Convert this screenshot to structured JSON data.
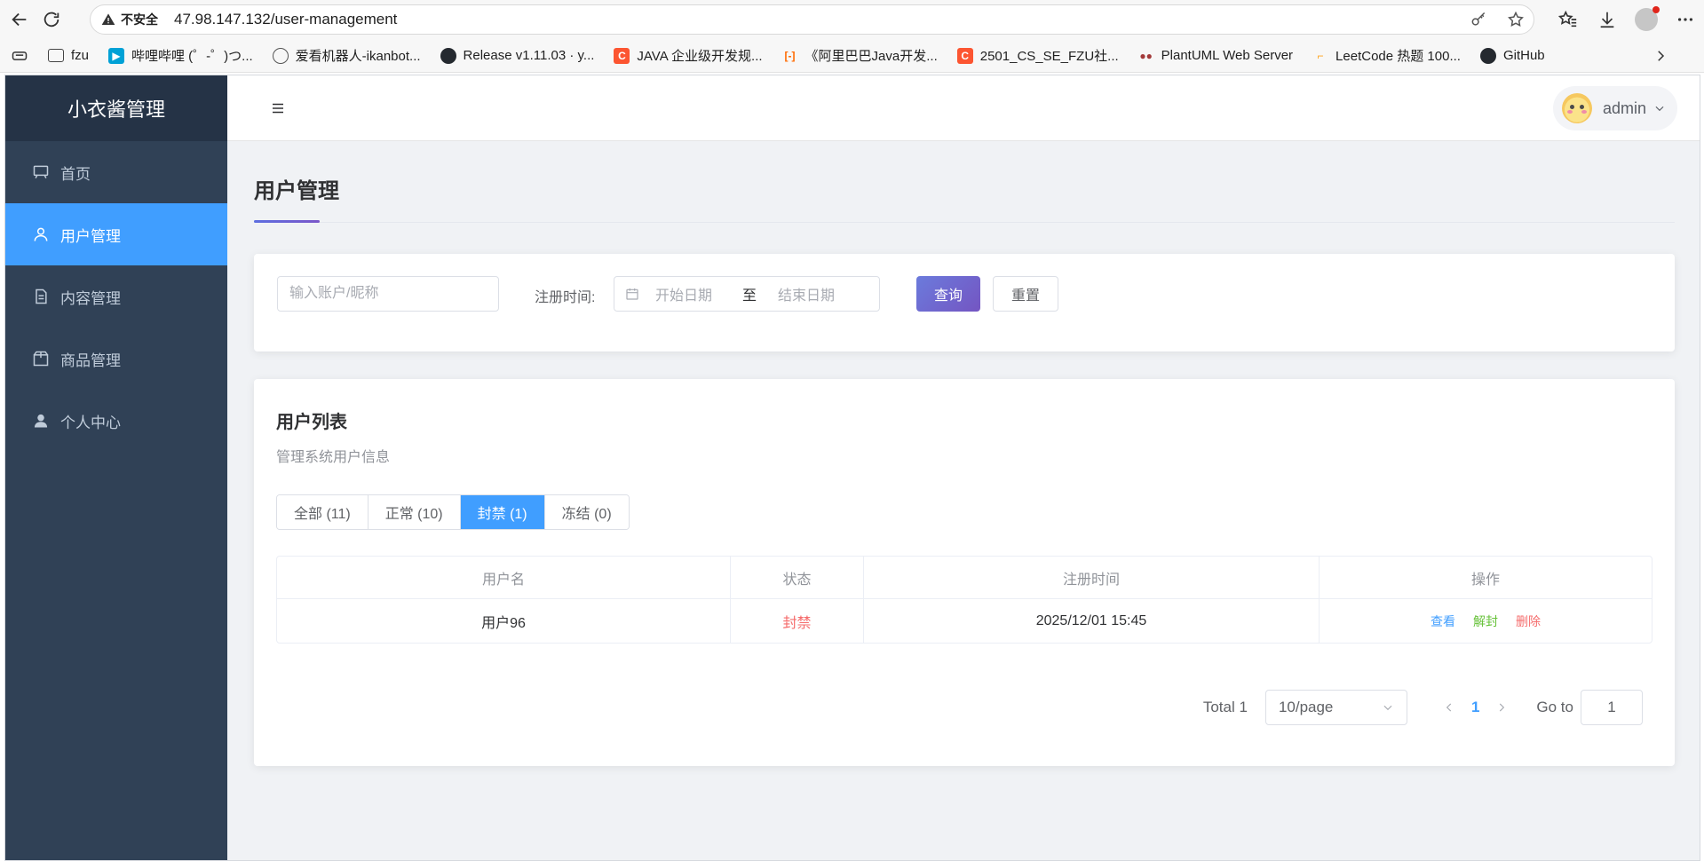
{
  "browser": {
    "security_label": "不安全",
    "url": "47.98.147.132/user-management",
    "bookmarks": [
      {
        "label": "fzu",
        "color": "#444444"
      },
      {
        "label": "哔哩哔哩 (゜-゜)つ...",
        "color": "#00a1d6"
      },
      {
        "label": "爱看机器人-ikanbot...",
        "color": "#555555"
      },
      {
        "label": "Release v1.11.03 · y...",
        "color": "#24292f"
      },
      {
        "label": "JAVA 企业级开发规...",
        "color": "#fc5531"
      },
      {
        "label": "《阿里巴巴Java开发...",
        "color": "#ff6a00"
      },
      {
        "label": "2501_CS_SE_FZU社...",
        "color": "#fc5531"
      },
      {
        "label": "PlantUML Web Server",
        "color": "#a33a3a"
      },
      {
        "label": "LeetCode 热题 100...",
        "color": "#ffa116"
      },
      {
        "label": "GitHub",
        "color": "#24292f"
      }
    ]
  },
  "app": {
    "name": "小衣酱管理",
    "menu": [
      {
        "label": "首页",
        "icon": "monitor-icon",
        "active": false
      },
      {
        "label": "用户管理",
        "icon": "user-icon",
        "active": true
      },
      {
        "label": "内容管理",
        "icon": "document-icon",
        "active": false
      },
      {
        "label": "商品管理",
        "icon": "box-icon",
        "active": false
      },
      {
        "label": "个人中心",
        "icon": "person-icon",
        "active": false
      }
    ],
    "user": "admin"
  },
  "page": {
    "title": "用户管理",
    "filter": {
      "search_placeholder": "输入账户/昵称",
      "reg_label": "注册时间:",
      "start_placeholder": "开始日期",
      "separator": "至",
      "end_placeholder": "结束日期",
      "query_label": "查询",
      "reset_label": "重置"
    },
    "list": {
      "title": "用户列表",
      "subtitle": "管理系统用户信息",
      "tabs": [
        {
          "label": "全部 (11)",
          "active": false
        },
        {
          "label": "正常 (10)",
          "active": false
        },
        {
          "label": "封禁 (1)",
          "active": true
        },
        {
          "label": "冻结 (0)",
          "active": false
        }
      ],
      "columns": [
        "用户名",
        "状态",
        "注册时间",
        "操作"
      ],
      "rows": [
        {
          "username": "用户96",
          "status": "封禁",
          "registered": "2025/12/01 15:45",
          "actions": [
            "查看",
            "解封",
            "删除"
          ]
        }
      ]
    },
    "pagination": {
      "total": "Total 1",
      "page_size": "10/page",
      "current": "1",
      "goto_label": "Go to",
      "goto_value": "1"
    }
  },
  "colors": {
    "sidebar": "#304156",
    "accent": "#409eff",
    "danger": "#f56c6c",
    "success": "#67c23a"
  }
}
